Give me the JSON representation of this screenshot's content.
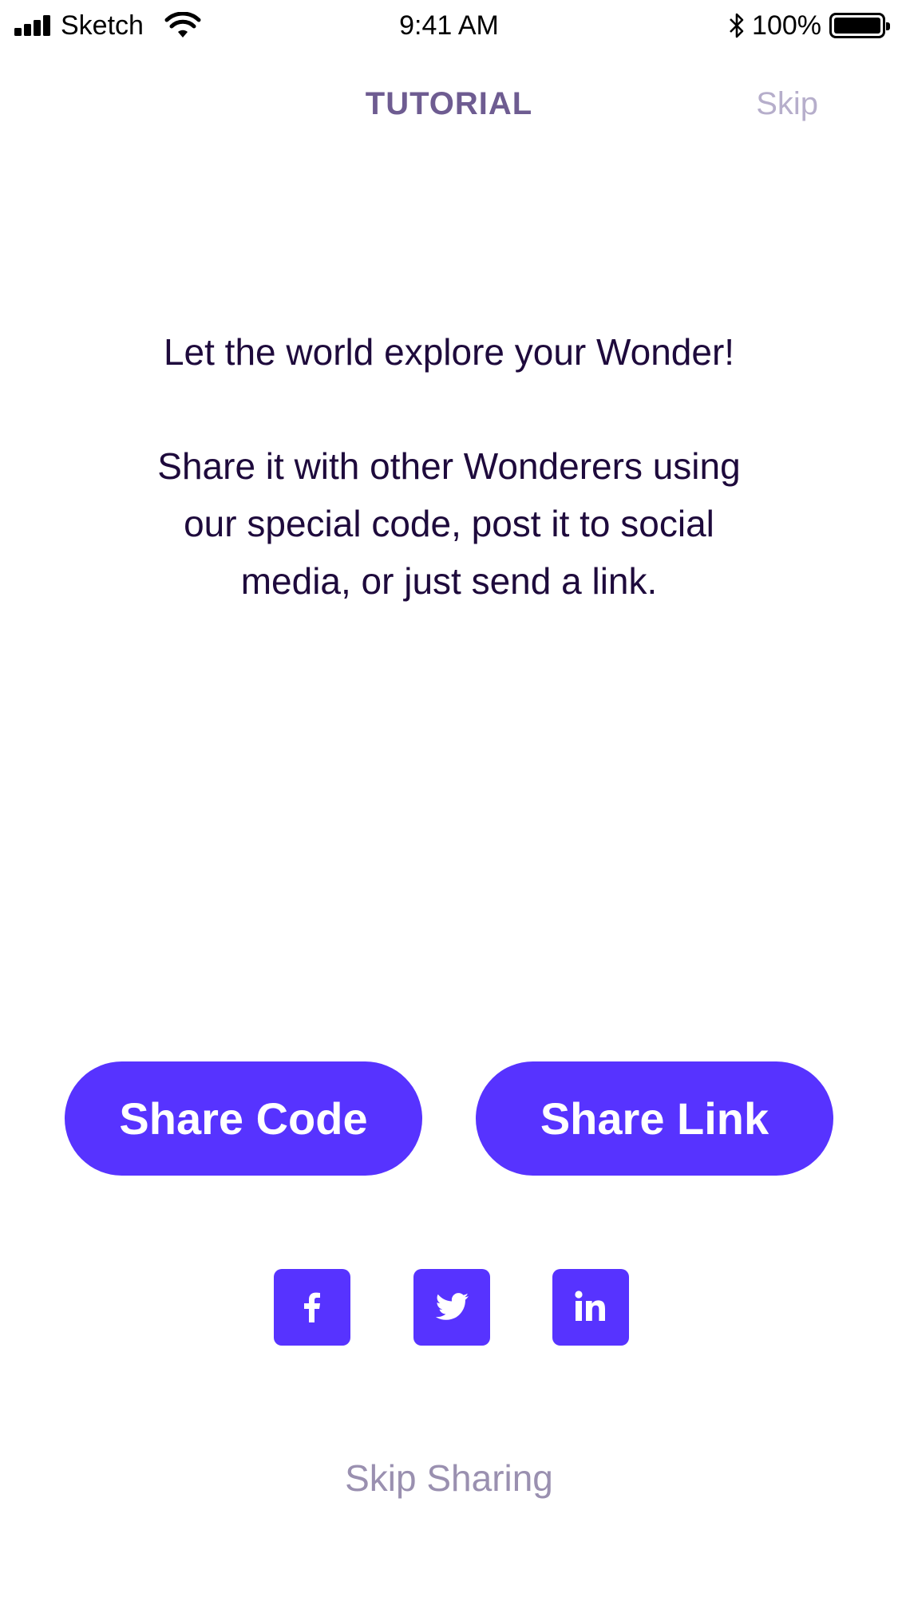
{
  "status_bar": {
    "carrier": "Sketch",
    "time": "9:41 AM",
    "battery_percent": "100%",
    "battery_level": 1.0,
    "icons": [
      "signal-icon",
      "wifi-icon",
      "bluetooth-icon",
      "battery-icon"
    ]
  },
  "header": {
    "title": "TUTORIAL",
    "skip_label": "Skip"
  },
  "content": {
    "intro": "Let the world explore your Wonder!",
    "description": "Share it with other Wonderers using our special code, post it to social media, or just send a link."
  },
  "actions": {
    "share_code_label": "Share Code",
    "share_link_label": "Share Link"
  },
  "social": {
    "icons": [
      "facebook-icon",
      "twitter-icon",
      "linkedin-icon"
    ]
  },
  "footer": {
    "skip_sharing_label": "Skip Sharing"
  },
  "colors": {
    "accent": "#5733FF",
    "title": "#6E5C91",
    "body_text": "#1E0A3C",
    "muted": "#9A90B0",
    "skip": "#B6AECB"
  }
}
